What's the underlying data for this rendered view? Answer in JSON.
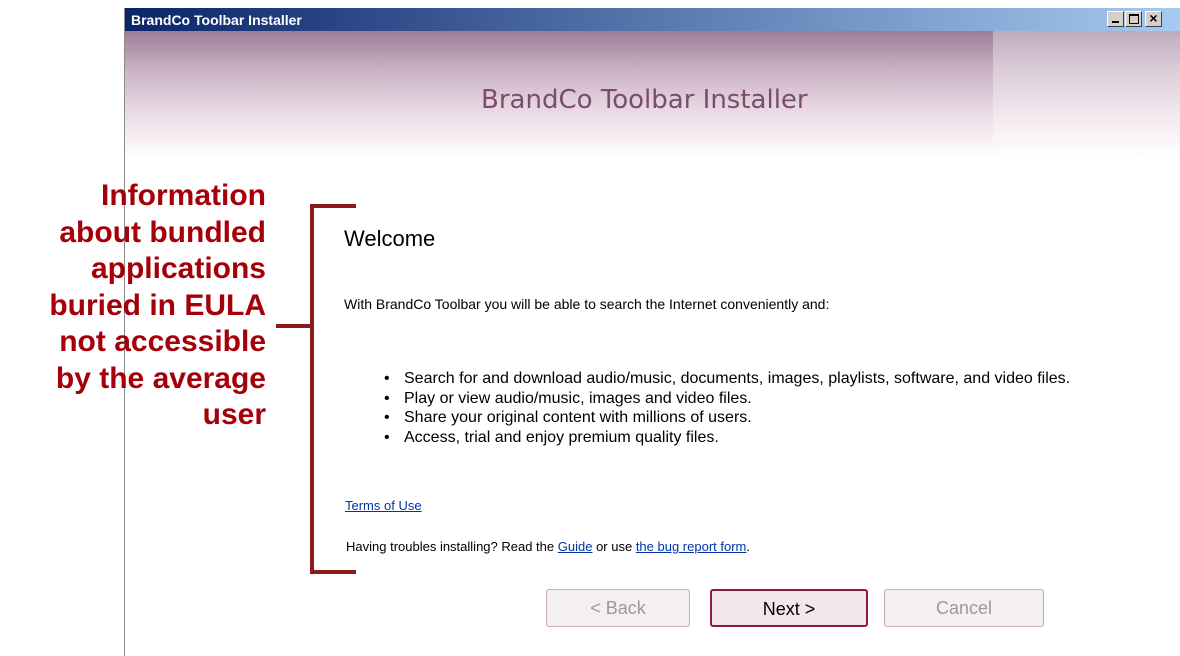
{
  "window": {
    "title": "BrandCo Toolbar Installer",
    "controls": {
      "minimize": "_",
      "maximize": "□",
      "close": "×"
    }
  },
  "banner": {
    "title": "BrandCo Toolbar Installer"
  },
  "annotation": {
    "lines": [
      "Information",
      "about bundled",
      "applications",
      "buried in EULA",
      "not accessible",
      "by the average",
      "user"
    ],
    "color": "#a5000a"
  },
  "content": {
    "heading": "Welcome",
    "intro": "With BrandCo Toolbar you will be able to search the Internet conveniently and:",
    "bullets": [
      "Search for and download audio/music, documents, images, playlists, software, and video files.",
      "Play or view audio/music, images and video files.",
      "Share your original content with millions of users.",
      "Access, trial and enjoy premium quality files."
    ],
    "terms_link": "Terms of Use",
    "help": {
      "prefix": "Having troubles installing? Read the ",
      "guide_link": "Guide",
      "middle": " or use ",
      "bug_link": "the bug report form",
      "suffix": "."
    }
  },
  "buttons": {
    "back": "< Back",
    "next": "Next >",
    "cancel": "Cancel"
  }
}
